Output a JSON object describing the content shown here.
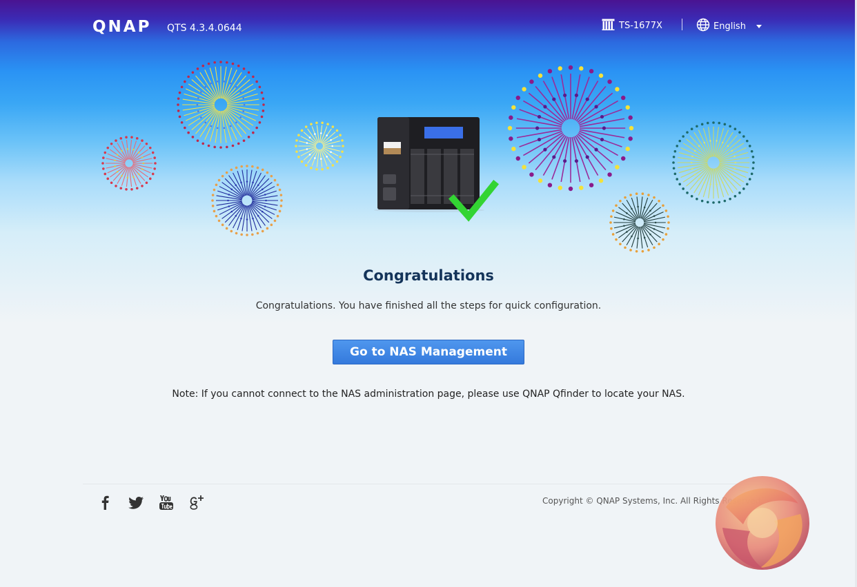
{
  "header": {
    "logo": "QNAP",
    "version": "QTS 4.3.4.0644",
    "model": "TS-1677X",
    "language": "English"
  },
  "icons": {
    "nas_model": "nas-server-icon",
    "language": "globe-icon",
    "check": "check-mark-icon"
  },
  "main": {
    "title": "Congratulations",
    "message": "Congratulations. You have finished all the steps for quick configuration.",
    "button_label": "Go to NAS Management",
    "note": "Note: If you cannot connect to the NAS administration page, please use QNAP Qfinder to locate your NAS."
  },
  "footer": {
    "social": [
      "facebook",
      "twitter",
      "youtube",
      "google-plus"
    ],
    "copyright": "Copyright © QNAP Systems, Inc. All Rights Reserved."
  },
  "colors": {
    "header_top": "#4a1391",
    "sky_blue": "#2a93f4",
    "button": "#3479dc",
    "title": "#14345a",
    "check": "#33d433"
  }
}
